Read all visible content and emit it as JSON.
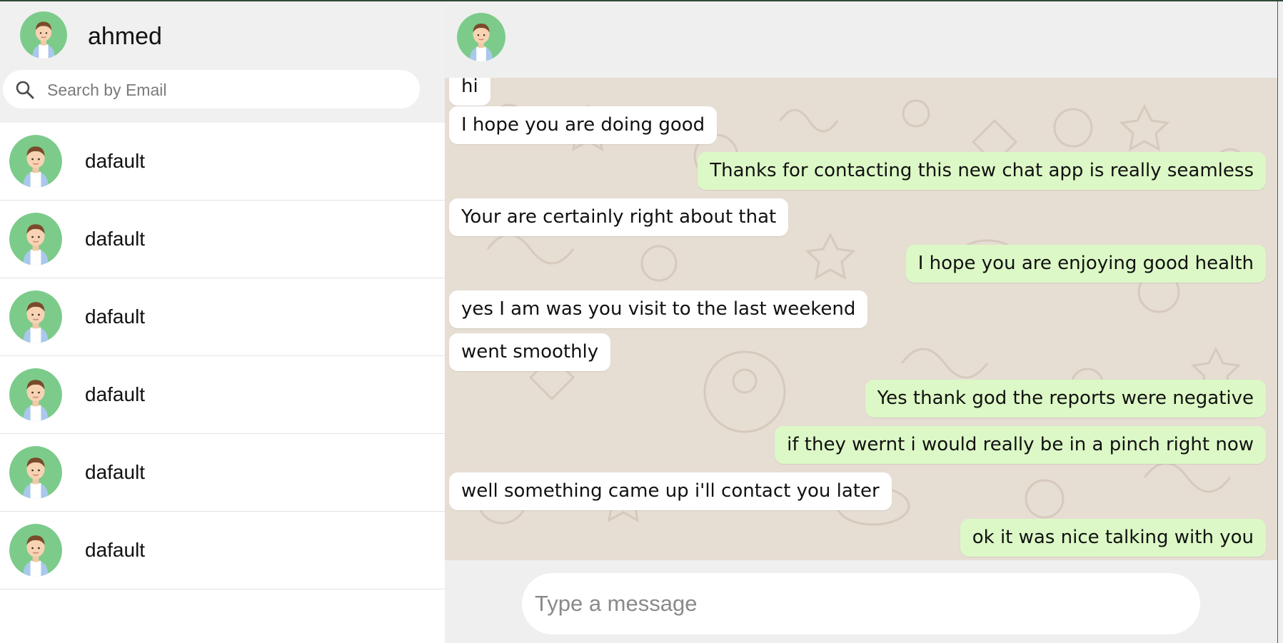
{
  "user": {
    "name": "ahmed",
    "avatar_icon": "default-avatar-icon"
  },
  "search": {
    "placeholder": "Search by Email",
    "value": ""
  },
  "contacts": [
    {
      "name": "dafault"
    },
    {
      "name": "dafault"
    },
    {
      "name": "dafault"
    },
    {
      "name": "dafault"
    },
    {
      "name": "dafault"
    },
    {
      "name": "dafault"
    }
  ],
  "chat": {
    "messages": [
      {
        "text": "hi",
        "direction": "in"
      },
      {
        "text": "I hope you are doing good",
        "direction": "in"
      },
      {
        "text": "Thanks for contacting this new chat app is really seamless",
        "direction": "out"
      },
      {
        "text": "Your are certainly right about that",
        "direction": "in"
      },
      {
        "text": "I hope you are enjoying good health",
        "direction": "out"
      },
      {
        "text": "yes I am was you visit to the last weekend",
        "direction": "in"
      },
      {
        "text": "went smoothly",
        "direction": "in"
      },
      {
        "text": "Yes thank god the reports were negative",
        "direction": "out"
      },
      {
        "text": "if they wernt i would really be in a pinch right now",
        "direction": "out"
      },
      {
        "text": "well something came up i'll contact you later",
        "direction": "in"
      },
      {
        "text": "ok it was nice talking with you",
        "direction": "out"
      }
    ]
  },
  "composer": {
    "placeholder": "Type a message",
    "value": ""
  },
  "colors": {
    "incoming_bubble": "#ffffff",
    "outgoing_bubble": "#dcf8c6",
    "chat_background": "#e6ddd3",
    "avatar_green": "#7ccb8b"
  }
}
